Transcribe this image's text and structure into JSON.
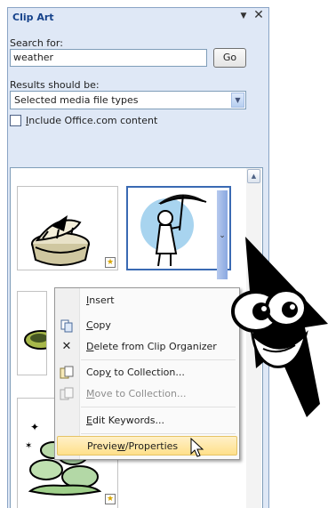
{
  "pane": {
    "title": "Clip Art",
    "menu_icon": "dropdown-arrow-icon",
    "close_icon": "close-icon"
  },
  "search": {
    "label": "Search for:",
    "value": "weather",
    "go_label": "Go"
  },
  "results_filter": {
    "label": "Results should be:",
    "selected": "Selected media file types"
  },
  "include_office": {
    "label_prefix": "",
    "label_accel": "I",
    "label_rest": "nclude Office.com content",
    "checked": false
  },
  "context_menu": {
    "items": [
      {
        "prefix": "",
        "accel": "I",
        "rest": "nsert",
        "icon": "none",
        "disabled": false
      },
      {
        "prefix": "",
        "accel": "C",
        "rest": "opy",
        "icon": "copy-icon",
        "disabled": false
      },
      {
        "prefix": "",
        "accel": "D",
        "rest": "elete from Clip Organizer",
        "icon": "delete-x-icon",
        "disabled": false
      },
      {
        "prefix": "Cop",
        "accel": "y",
        "rest": " to Collection...",
        "icon": "copy-to-collection-icon",
        "disabled": false
      },
      {
        "prefix": "",
        "accel": "M",
        "rest": "ove to Collection...",
        "icon": "move-to-collection-icon",
        "disabled": true
      },
      {
        "prefix": "",
        "accel": "E",
        "rest": "dit Keywords...",
        "icon": "none",
        "disabled": false
      },
      {
        "prefix": "Previe",
        "accel": "w",
        "rest": "/Properties",
        "icon": "none",
        "disabled": false
      }
    ]
  },
  "colors": {
    "pane_bg": "#dfe8f6",
    "title_text": "#15428b",
    "selected_border": "#3a6ab3",
    "menu_hover": "#ffe08a"
  }
}
